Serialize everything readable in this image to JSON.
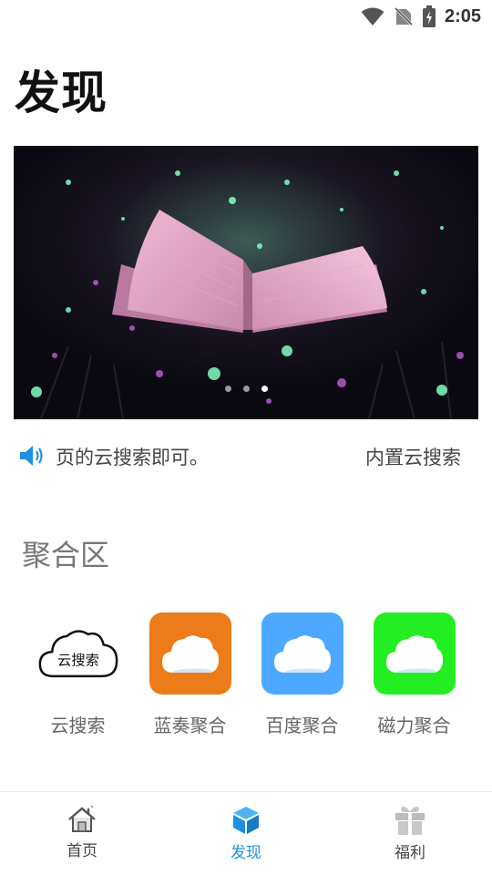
{
  "status_bar": {
    "time": "2:05"
  },
  "page": {
    "title": "发现"
  },
  "banner": {
    "slide_count": 3,
    "active_index": 2
  },
  "notice": {
    "text_1": "页的云搜索即可。",
    "text_2": "内置云搜索"
  },
  "section": {
    "title": "聚合区"
  },
  "grid": [
    {
      "label": "云搜索",
      "icon": "cloud-search-icon",
      "tile_color": "transparent",
      "cloud_text": "云搜索"
    },
    {
      "label": "蓝奏聚合",
      "icon": "cloud-icon",
      "tile_color": "#ec7b19"
    },
    {
      "label": "百度聚合",
      "icon": "cloud-icon",
      "tile_color": "#4da9ff"
    },
    {
      "label": "磁力聚合",
      "icon": "cloud-icon",
      "tile_color": "#22ee22"
    }
  ],
  "nav": [
    {
      "label": "首页",
      "icon": "home-icon",
      "active": false
    },
    {
      "label": "发现",
      "icon": "cube-icon",
      "active": true
    },
    {
      "label": "福利",
      "icon": "gift-icon",
      "active": false
    }
  ],
  "colors": {
    "accent": "#1e90e0",
    "title": "#111111",
    "section": "#777777"
  }
}
